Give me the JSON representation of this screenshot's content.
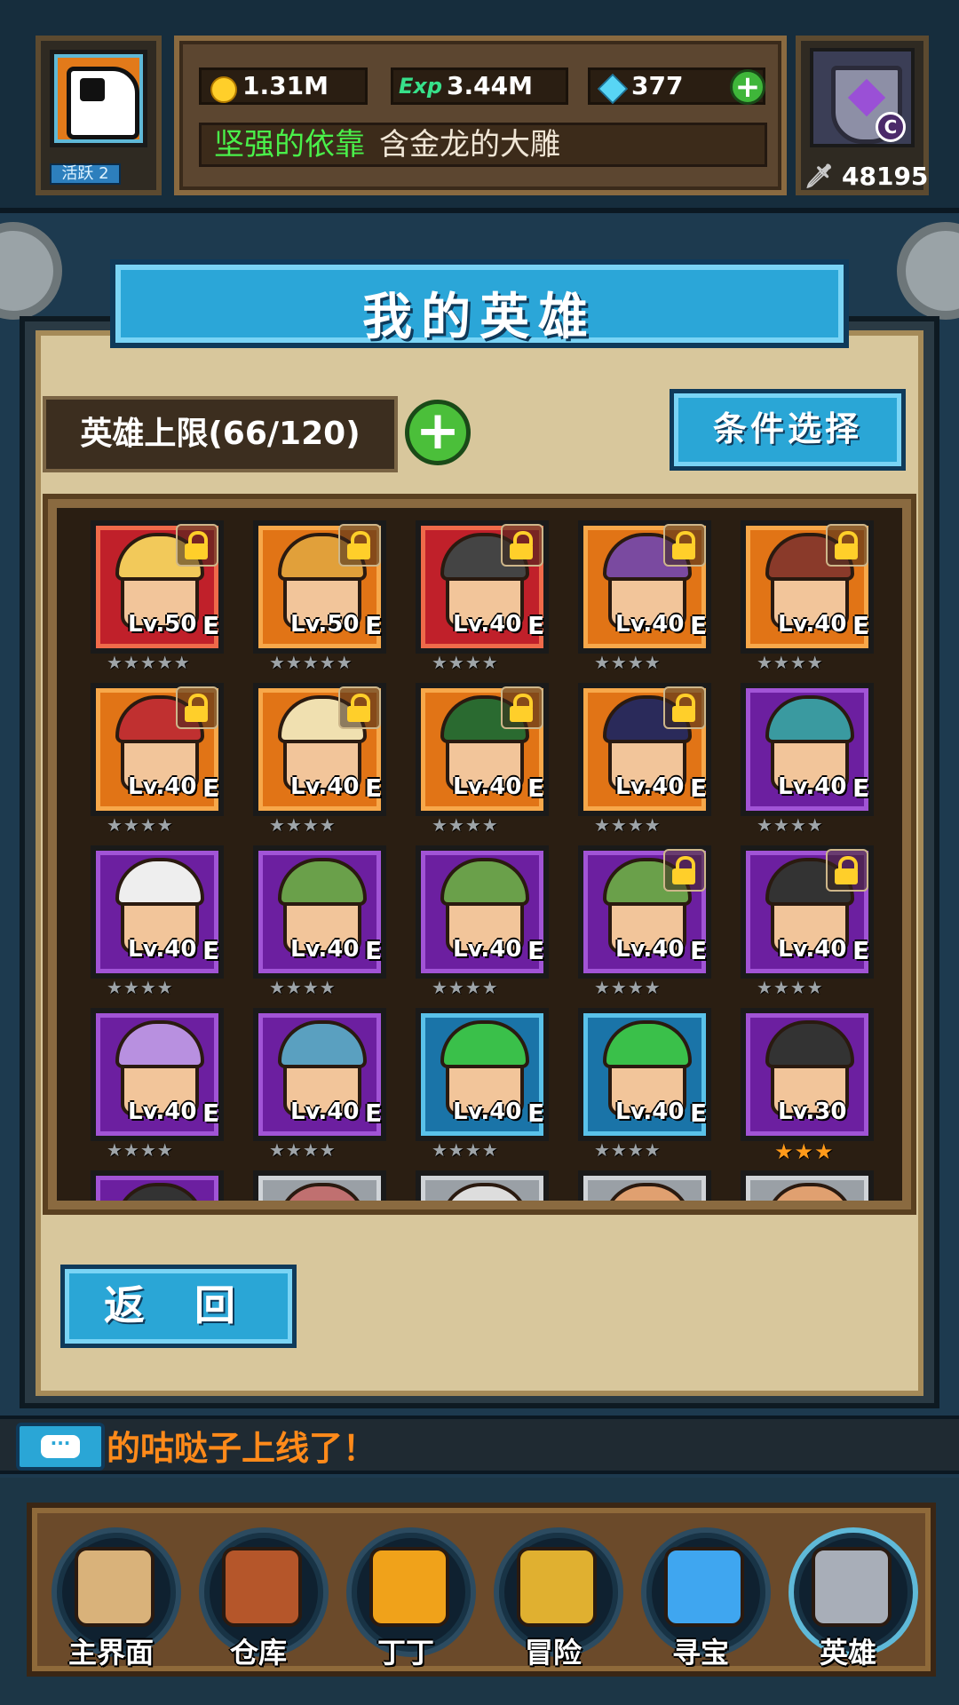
{
  "player": {
    "active_label": "活跃 2",
    "gold": "1.31M",
    "exp_label": "Exp",
    "exp": "3.44M",
    "gems": "377",
    "title_prefix": "坚强的依靠",
    "title_name": "含金龙的大雕",
    "weapon_grade": "C",
    "power": "48195"
  },
  "page": {
    "title": "我的英雄",
    "capacity": "英雄上限(66/120)",
    "filter_label": "条件选择",
    "back_label": "返 回"
  },
  "heroes": [
    {
      "level": "Lv.50",
      "grade": "E",
      "stars": "★★★★★",
      "rarity": "red",
      "locked": true
    },
    {
      "level": "Lv.50",
      "grade": "E",
      "stars": "★★★★★",
      "rarity": "orange",
      "locked": true
    },
    {
      "level": "Lv.40",
      "grade": "E",
      "stars": "★★★★",
      "rarity": "red",
      "locked": true
    },
    {
      "level": "Lv.40",
      "grade": "E",
      "stars": "★★★★",
      "rarity": "orange",
      "locked": true
    },
    {
      "level": "Lv.40",
      "grade": "E",
      "stars": "★★★★",
      "rarity": "orange",
      "locked": true
    },
    {
      "level": "Lv.40",
      "grade": "E",
      "stars": "★★★★",
      "rarity": "orange",
      "locked": true
    },
    {
      "level": "Lv.40",
      "grade": "E",
      "stars": "★★★★",
      "rarity": "orange",
      "locked": true
    },
    {
      "level": "Lv.40",
      "grade": "E",
      "stars": "★★★★",
      "rarity": "orange",
      "locked": true
    },
    {
      "level": "Lv.40",
      "grade": "E",
      "stars": "★★★★",
      "rarity": "orange",
      "locked": true
    },
    {
      "level": "Lv.40",
      "grade": "E",
      "stars": "★★★★",
      "rarity": "purple",
      "locked": false
    },
    {
      "level": "Lv.40",
      "grade": "E",
      "stars": "★★★★",
      "rarity": "purple",
      "locked": false
    },
    {
      "level": "Lv.40",
      "grade": "E",
      "stars": "★★★★",
      "rarity": "purple",
      "locked": false
    },
    {
      "level": "Lv.40",
      "grade": "E",
      "stars": "★★★★",
      "rarity": "purple",
      "locked": false
    },
    {
      "level": "Lv.40",
      "grade": "E",
      "stars": "★★★★",
      "rarity": "purple",
      "locked": true
    },
    {
      "level": "Lv.40",
      "grade": "E",
      "stars": "★★★★",
      "rarity": "purple",
      "locked": true
    },
    {
      "level": "Lv.40",
      "grade": "E",
      "stars": "★★★★",
      "rarity": "purple",
      "locked": false
    },
    {
      "level": "Lv.40",
      "grade": "E",
      "stars": "★★★★",
      "rarity": "purple",
      "locked": false
    },
    {
      "level": "Lv.40",
      "grade": "E",
      "stars": "★★★★",
      "rarity": "blue",
      "locked": false
    },
    {
      "level": "Lv.40",
      "grade": "E",
      "stars": "★★★★",
      "rarity": "blue",
      "locked": false
    },
    {
      "level": "Lv.30",
      "grade": "",
      "stars": "★★★",
      "rarity": "purple",
      "locked": false,
      "stars_color": "orange"
    },
    {
      "level": "",
      "grade": "",
      "stars": "",
      "rarity": "purple",
      "locked": false
    },
    {
      "level": "",
      "grade": "",
      "stars": "",
      "rarity": "gray",
      "locked": false
    },
    {
      "level": "",
      "grade": "",
      "stars": "",
      "rarity": "gray",
      "locked": false
    },
    {
      "level": "",
      "grade": "",
      "stars": "",
      "rarity": "gray",
      "locked": false
    },
    {
      "level": "",
      "grade": "",
      "stars": "",
      "rarity": "gray",
      "locked": false
    }
  ],
  "chat": {
    "message": "的咕哒子上线了！"
  },
  "nav": [
    {
      "label": "主界面",
      "icon": "scroll-icon",
      "color": "#d9b27a"
    },
    {
      "label": "仓库",
      "icon": "chest-icon",
      "color": "#b5562a"
    },
    {
      "label": "丁丁",
      "icon": "alarm-clock-icon",
      "color": "#f0a21a"
    },
    {
      "label": "冒险",
      "icon": "sword-emblem-icon",
      "color": "#e0b030"
    },
    {
      "label": "寻宝",
      "icon": "crystal-icon",
      "color": "#3fa6f0"
    },
    {
      "label": "英雄",
      "icon": "knight-helmet-icon",
      "color": "#a8aeb8"
    }
  ]
}
